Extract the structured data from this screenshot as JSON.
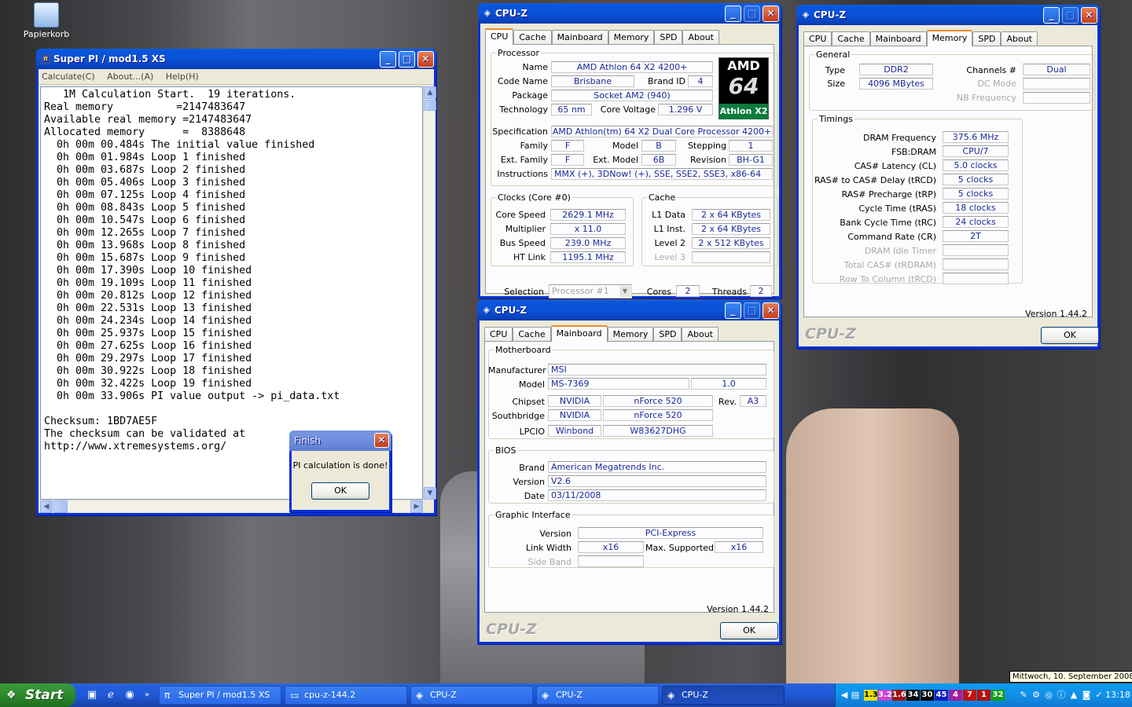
{
  "desktop": {
    "recycle_bin": "Papierkorb",
    "date_tooltip": "Mittwoch, 10. September 2008"
  },
  "superpi": {
    "title": "Super PI / mod1.5 XS",
    "menu": [
      "Calculate(C)",
      "About...(A)",
      "Help(H)"
    ],
    "output": "   1M Calculation Start.  19 iterations.\nReal memory          =2147483647\nAvailable real memory =2147483647\nAllocated memory      =  8388648\n  0h 00m 00.484s The initial value finished\n  0h 00m 01.984s Loop 1 finished\n  0h 00m 03.687s Loop 2 finished\n  0h 00m 05.406s Loop 3 finished\n  0h 00m 07.125s Loop 4 finished\n  0h 00m 08.843s Loop 5 finished\n  0h 00m 10.547s Loop 6 finished\n  0h 00m 12.265s Loop 7 finished\n  0h 00m 13.968s Loop 8 finished\n  0h 00m 15.687s Loop 9 finished\n  0h 00m 17.390s Loop 10 finished\n  0h 00m 19.109s Loop 11 finished\n  0h 00m 20.812s Loop 12 finished\n  0h 00m 22.531s Loop 13 finished\n  0h 00m 24.234s Loop 14 finished\n  0h 00m 25.937s Loop 15 finished\n  0h 00m 27.625s Loop 16 finished\n  0h 00m 29.297s Loop 17 finished\n  0h 00m 30.922s Loop 18 finished\n  0h 00m 32.422s Loop 19 finished\n  0h 00m 33.906s PI value output -> pi_data.txt\n\nChecksum: 1BD7AE5F\nThe checksum can be validated at\nhttp://www.xtremesystems.org/"
  },
  "finish_dialog": {
    "title": "Finish",
    "message": "PI calculation is done!",
    "ok": "OK"
  },
  "cpuz_common": {
    "title": "CPU-Z",
    "tabs": [
      "CPU",
      "Cache",
      "Mainboard",
      "Memory",
      "SPD",
      "About"
    ],
    "version": "Version 1.44.2",
    "logo": "CPU-Z",
    "ok": "OK"
  },
  "cpu_tab": {
    "processor_group": "Processor",
    "name_label": "Name",
    "name": "AMD Athlon 64 X2 4200+",
    "codename_label": "Code Name",
    "codename": "Brisbane",
    "brandid_label": "Brand ID",
    "brandid": "4",
    "package_label": "Package",
    "package": "Socket AM2 (940)",
    "technology_label": "Technology",
    "technology": "65 nm",
    "voltage_label": "Core Voltage",
    "voltage": "1.296 V",
    "spec_label": "Specification",
    "spec": "AMD Athlon(tm) 64 X2 Dual Core Processor 4200+",
    "family_label": "Family",
    "family": "F",
    "model_label": "Model",
    "model": "B",
    "stepping_label": "Stepping",
    "stepping": "1",
    "extfamily_label": "Ext. Family",
    "extfamily": "F",
    "extmodel_label": "Ext. Model",
    "extmodel": "6B",
    "revision_label": "Revision",
    "revision": "BH-G1",
    "instructions_label": "Instructions",
    "instructions": "MMX (+), 3DNow! (+), SSE, SSE2, SSE3, x86-64",
    "clocks_group": "Clocks (Core #0)",
    "corespeed_label": "Core Speed",
    "corespeed": "2629.1 MHz",
    "multiplier_label": "Multiplier",
    "multiplier": "x 11.0",
    "busspeed_label": "Bus Speed",
    "busspeed": "239.0 MHz",
    "htlink_label": "HT Link",
    "htlink": "1195.1 MHz",
    "cache_group": "Cache",
    "l1data_label": "L1 Data",
    "l1data": "2 x 64 KBytes",
    "l1inst_label": "L1 Inst.",
    "l1inst": "2 x 64 KBytes",
    "level2_label": "Level 2",
    "level2": "2 x 512 KBytes",
    "level3_label": "Level 3",
    "selection_label": "Selection",
    "selection": "Processor #1",
    "cores_label": "Cores",
    "cores": "2",
    "threads_label": "Threads",
    "threads": "2",
    "amd_logo_top": "AMD",
    "amd_logo_mid": "64",
    "amd_logo_bottom": "Athlon X2"
  },
  "mainboard_tab": {
    "motherboard_group": "Motherboard",
    "manufacturer_label": "Manufacturer",
    "manufacturer": "MSI",
    "model_label": "Model",
    "model": "MS-7369",
    "model_rev": "1.0",
    "chipset_label": "Chipset",
    "chipset_vendor": "NVIDIA",
    "chipset_name": "nForce 520",
    "rev_label": "Rev.",
    "rev": "A3",
    "southbridge_label": "Southbridge",
    "sb_vendor": "NVIDIA",
    "sb_name": "nForce 520",
    "lpcio_label": "LPCIO",
    "lpcio_vendor": "Winbond",
    "lpcio_name": "W83627DHG",
    "bios_group": "BIOS",
    "brand_label": "Brand",
    "brand": "American Megatrends Inc.",
    "version_label": "Version",
    "version": "V2.6",
    "date_label": "Date",
    "date": "03/11/2008",
    "graphic_group": "Graphic Interface",
    "gi_version_label": "Version",
    "gi_version": "PCI-Express",
    "linkwidth_label": "Link Width",
    "linkwidth": "x16",
    "maxsupported_label": "Max. Supported",
    "maxsupported": "x16",
    "sideband_label": "Side Band"
  },
  "memory_tab": {
    "general_group": "General",
    "type_label": "Type",
    "type": "DDR2",
    "channels_label": "Channels #",
    "channels": "Dual",
    "size_label": "Size",
    "size": "4096 MBytes",
    "dcmode_label": "DC Mode",
    "nbfreq_label": "NB Frequency",
    "timings_group": "Timings",
    "dramfreq_label": "DRAM Frequency",
    "dramfreq": "375.6 MHz",
    "fsbdram_label": "FSB:DRAM",
    "fsbdram": "CPU/7",
    "cas_label": "CAS# Latency (CL)",
    "cas": "5.0 clocks",
    "trcd_label": "RAS# to CAS# Delay (tRCD)",
    "trcd": "5 clocks",
    "trp_label": "RAS# Precharge (tRP)",
    "trp": "5 clocks",
    "tras_label": "Cycle Time (tRAS)",
    "tras": "18 clocks",
    "trc_label": "Bank Cycle Time (tRC)",
    "trc": "24 clocks",
    "cr_label": "Command Rate (CR)",
    "cr": "2T",
    "idle_label": "DRAM Idle Timer",
    "totalcas_label": "Total CAS# (tRDRAM)",
    "rowcol_label": "Row To Column (tRCD)"
  },
  "taskbar": {
    "start": "Start",
    "tasks": [
      "Super PI / mod1.5 XS",
      "cpu-z-144.2",
      "CPU-Z",
      "CPU-Z",
      "CPU-Z"
    ],
    "tray_numbers": [
      "1.3",
      "3.2",
      "1.6",
      "34",
      "30",
      "45",
      "4",
      "7",
      "1",
      "32"
    ],
    "tray_colors": [
      "#e8e000",
      "#d040d0",
      "#a01010",
      "#000000",
      "#000000",
      "#1020c0",
      "#a020a0",
      "#c01010",
      "#b01010",
      "#10a010"
    ],
    "clock": "13:18"
  }
}
